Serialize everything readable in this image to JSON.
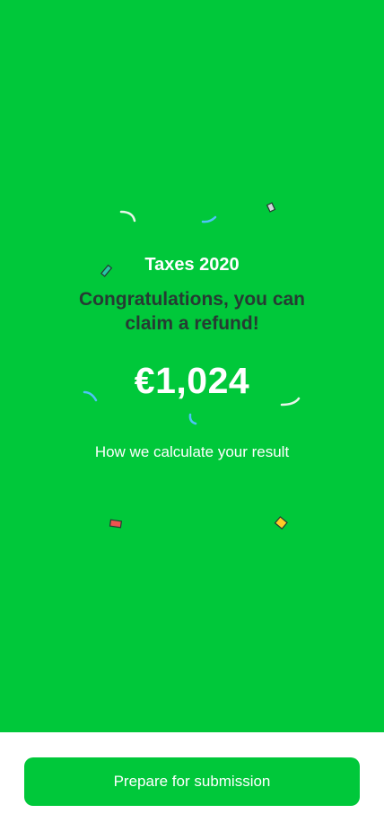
{
  "result": {
    "year_title": "Taxes 2020",
    "headline": "Congratulations, you can claim a refund!",
    "amount": "€1,024",
    "calculation_link": "How we calculate your result"
  },
  "footer": {
    "primary_button": "Prepare for submission"
  },
  "colors": {
    "accent_green": "#00c83a",
    "headline_dark": "#263b33",
    "confetti_blue": "#4fc3f7",
    "confetti_red": "#ef5350",
    "confetti_yellow": "#ffca28",
    "confetti_white": "#e8f5e9",
    "confetti_teal": "#26c6a6"
  },
  "icons": [
    "confetti-decoration"
  ]
}
